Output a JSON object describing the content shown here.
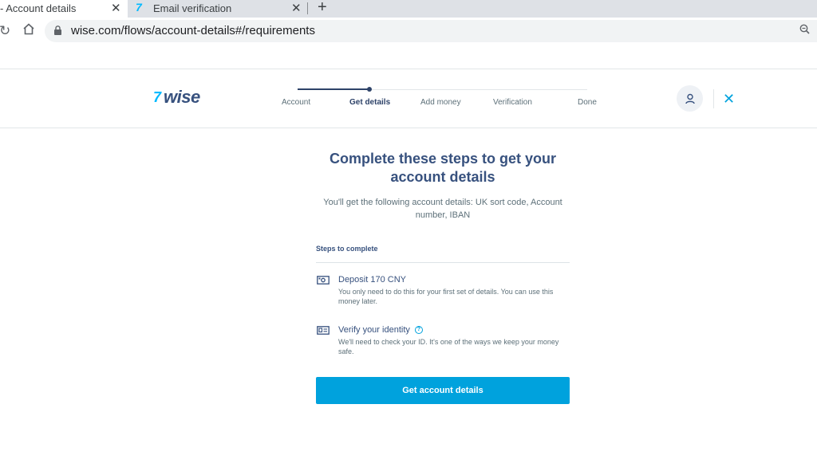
{
  "browser": {
    "tabs": [
      {
        "title": "- Account details",
        "close": "✕"
      },
      {
        "title": "Email verification",
        "close": "✕",
        "favicon": "7"
      }
    ],
    "new_tab": "+",
    "url": "wise.com/flows/account-details#/requirements"
  },
  "header": {
    "logo_flag": "7",
    "logo_text": "wise",
    "steps": [
      {
        "label": "Account",
        "state": "done"
      },
      {
        "label": "Get details",
        "state": "current"
      },
      {
        "label": "Add money",
        "state": "upcoming"
      },
      {
        "label": "Verification",
        "state": "upcoming"
      },
      {
        "label": "Done",
        "state": "upcoming"
      }
    ],
    "close": "✕"
  },
  "main": {
    "title": "Complete these steps to get your account details",
    "subtitle": "You'll get the following account details: UK sort code, Account number, IBAN",
    "section_label": "Steps to complete",
    "requirements": [
      {
        "title": "Deposit 170 CNY",
        "description": "You only need to do this for your first set of details. You can use this money later.",
        "icon": "cash-icon"
      },
      {
        "title": "Verify your identity",
        "description": "We'll need to check your ID. It's one of the ways we keep your money safe.",
        "icon": "id-card-icon",
        "help": "?"
      }
    ],
    "cta_label": "Get account details"
  },
  "colors": {
    "brand_navy": "#37517e",
    "accent_blue": "#00a2dd",
    "logo_blue": "#00b9ff"
  }
}
